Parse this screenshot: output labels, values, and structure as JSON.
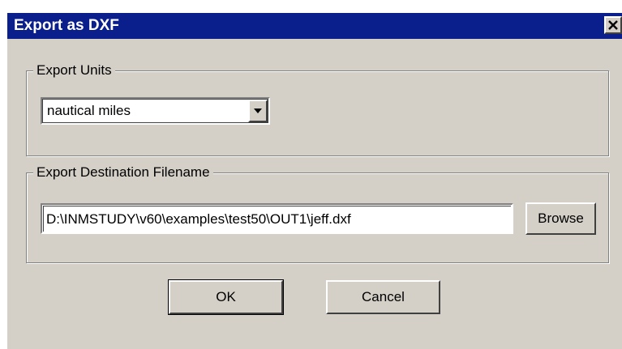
{
  "window": {
    "title": "Export as DXF",
    "close_symbol": "×"
  },
  "export_units": {
    "group_label": "Export Units",
    "selected": "nautical miles",
    "dropdown_icon": "triangle-down"
  },
  "export_destination": {
    "group_label": "Export Destination Filename",
    "filename": "D:\\INMSTUDY\\v60\\examples\\test50\\OUT1\\jeff.dxf",
    "browse_label": "Browse"
  },
  "buttons": {
    "ok_label": "OK",
    "cancel_label": "Cancel"
  },
  "colors": {
    "titlebar": "#0a1e8c",
    "face": "#d4d0c8",
    "title_text": "#ffffff"
  }
}
